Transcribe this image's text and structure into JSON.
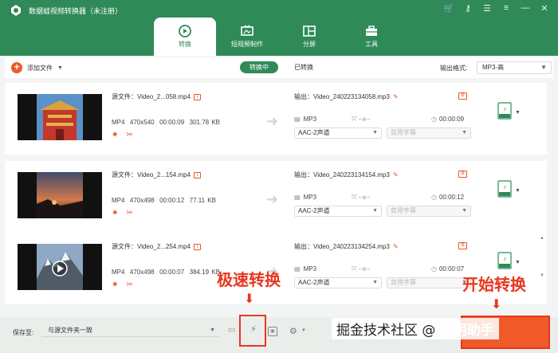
{
  "app": {
    "title": "数据蛙视频转换器（未注册）"
  },
  "tabs": [
    {
      "label": "转换",
      "icon": "refresh-icon",
      "active": true
    },
    {
      "label": "短视频制作",
      "icon": "tv-icon",
      "active": false
    },
    {
      "label": "分屏",
      "icon": "split-screen-icon",
      "active": false
    },
    {
      "label": "工具",
      "icon": "toolbox-icon",
      "active": false
    }
  ],
  "toolbar": {
    "add_label": "添加文件",
    "seg_converting": "转换中",
    "seg_converted": "已转换",
    "output_format_label": "输出格式:",
    "output_format_value": "MP3-高"
  },
  "rows": [
    {
      "src": "源文件：Video_2...058.mp4",
      "fmt": "MP4",
      "res": "470x540",
      "dur": "00:00:09",
      "size": "301.78 KB",
      "out": "输出：Video_240223134058.mp3",
      "ofmt": "MP3",
      "ores": "--x--",
      "odur": "00:00:09",
      "audio": "AAC-2声道",
      "sub": "禁用字幕"
    },
    {
      "src": "源文件：Video_2...154.mp4",
      "fmt": "MP4",
      "res": "470x498",
      "dur": "00:00:12",
      "size": "77.11 KB",
      "out": "输出：Video_240223134154.mp3",
      "ofmt": "MP3",
      "ores": "--x--",
      "odur": "00:00:12",
      "audio": "AAC-2声道",
      "sub": "禁用字幕"
    },
    {
      "src": "源文件：Video_2...254.mp4",
      "fmt": "MP4",
      "res": "470x498",
      "dur": "00:00:07",
      "size": "384.19 KB",
      "out": "输出：Video_240223134254.mp3",
      "ofmt": "MP3",
      "ores": "--x--",
      "odur": "00:00:07",
      "audio": "AAC-2声道",
      "sub": "禁用字幕"
    }
  ],
  "footer": {
    "save_label": "保存至:",
    "save_value": "与源文件夹一致"
  },
  "annotations": {
    "speed": "极速转换",
    "start": "开始转换"
  },
  "watermark": {
    "site": "掘金技术社区",
    "sep": "@",
    "author": "小明助手"
  },
  "colors": {
    "brand": "#2f8a57",
    "accent": "#f05a28",
    "annotation": "#e8361e"
  }
}
